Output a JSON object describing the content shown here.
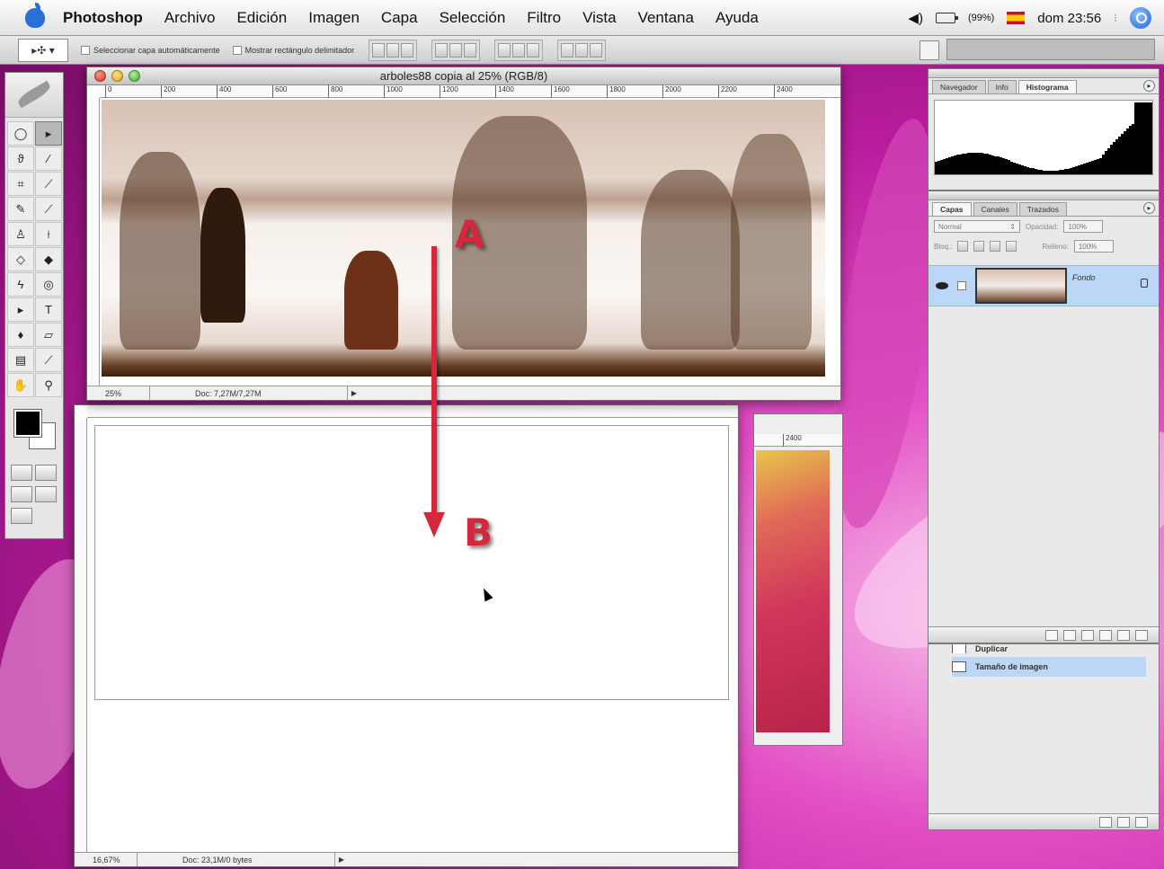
{
  "menubar": {
    "app": "Photoshop",
    "items": [
      "Archivo",
      "Edición",
      "Imagen",
      "Capa",
      "Selección",
      "Filtro",
      "Vista",
      "Ventana",
      "Ayuda"
    ],
    "battery": "(99%)",
    "clock": "dom 23:56"
  },
  "options": {
    "auto_select": "Seleccionar capa automáticamente",
    "show_bounds": "Mostrar rectángulo delimitador"
  },
  "doc_top": {
    "title": "arboles88 copia al 25% (RGB/8)",
    "ruler_ticks": [
      "0",
      "200",
      "400",
      "600",
      "800",
      "1000",
      "1200",
      "1400",
      "1600",
      "1800",
      "2000",
      "2200",
      "2400"
    ],
    "zoom": "25%",
    "doc_size": "Doc: 7,27M/7,27M"
  },
  "doc_blank": {
    "zoom": "16,67%",
    "doc_size": "Doc: 23,1M/0 bytes"
  },
  "doc_pink": {
    "ruler_tick": "2400"
  },
  "panel_info": {
    "tabs": [
      "Navegador",
      "Info",
      "Histograma"
    ]
  },
  "panel_layers": {
    "tabs": [
      "Capas",
      "Canales",
      "Trazados"
    ],
    "blend_mode": "Normal",
    "opacity_label": "Opacidad:",
    "opacity_value": "100%",
    "lock_label": "Bloq.:",
    "fill_label": "Relleno:",
    "fill_value": "100%",
    "layer_name": "Fondo"
  },
  "panel_history": {
    "items": [
      "Duplicar",
      "Tamaño de imagen"
    ]
  },
  "annotations": {
    "a": "A",
    "b": "B"
  }
}
